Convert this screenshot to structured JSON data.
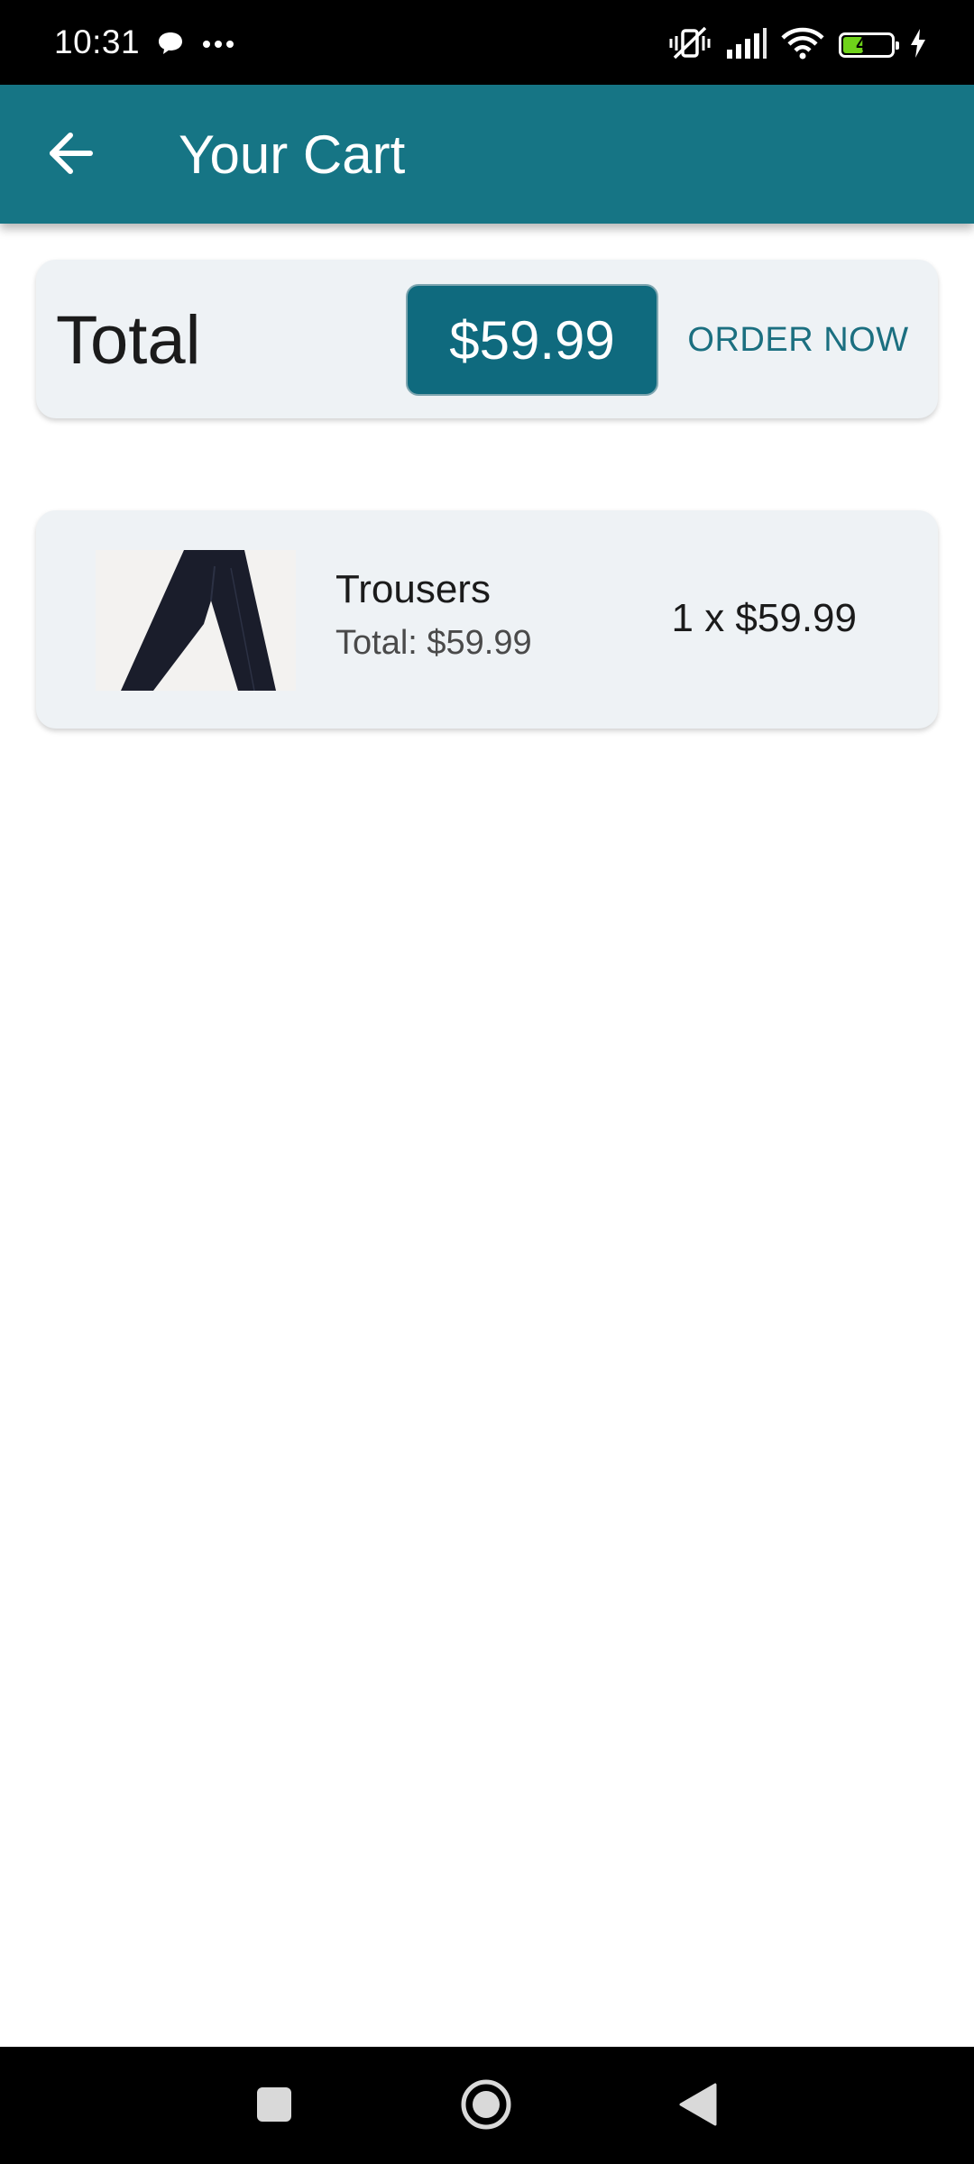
{
  "status_bar": {
    "time": "10:31",
    "battery_level": "40",
    "icons": [
      "chat-bubble-icon",
      "more-dots-icon",
      "vibrate-off-icon",
      "signal-icon",
      "wifi-icon",
      "battery-icon",
      "charging-bolt-icon"
    ]
  },
  "app_bar": {
    "title": "Your Cart",
    "back_icon": "arrow-left-icon"
  },
  "summary": {
    "total_label": "Total",
    "total_price": "$59.99",
    "order_button_label": "ORDER NOW"
  },
  "cart": {
    "items": [
      {
        "name": "Trousers",
        "total_text": "Total: $59.99",
        "quantity_price": "1 x $59.99",
        "image_icon": "trousers-image"
      }
    ]
  },
  "nav_bar": {
    "icons": [
      "recent-apps-icon",
      "home-icon",
      "back-triangle-icon"
    ]
  },
  "colors": {
    "app_bar": "#167585",
    "price_chip": "#0f6a7e",
    "order_text": "#1b6f80",
    "card_bg": "#eef2f5",
    "battery_fill": "#6fd21a"
  }
}
